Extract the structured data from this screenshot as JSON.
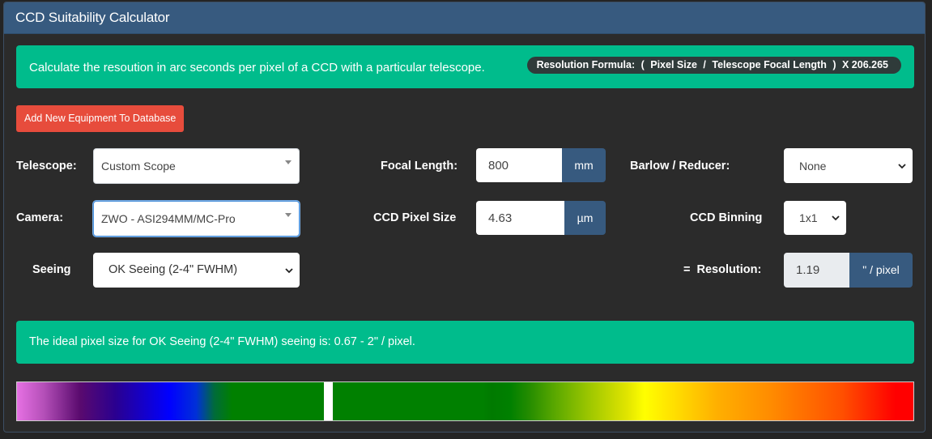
{
  "header": {
    "title": "CCD Suitability Calculator"
  },
  "info": {
    "description": "Calculate the resoution in arc seconds per pixel of a CCD with a particular telescope.",
    "formula": [
      "Resolution Formula:",
      "(",
      "Pixel Size",
      "/",
      "Telescope Focal Length",
      ")",
      "X 206.265"
    ]
  },
  "add_button_label": "Add New Equipment To Database",
  "telescope": {
    "label": "Telescope:",
    "value": "Custom Scope"
  },
  "focal_length": {
    "label": "Focal Length:",
    "value": "800",
    "unit": "mm"
  },
  "barlow": {
    "label": "Barlow / Reducer:",
    "value": "None"
  },
  "camera": {
    "label": "Camera:",
    "value": "ZWO - ASI294MM/MC-Pro"
  },
  "pixel_size": {
    "label": "CCD Pixel Size",
    "value": "4.63",
    "unit": "µm"
  },
  "binning": {
    "label": "CCD Binning",
    "value": "1x1"
  },
  "seeing": {
    "label": "Seeing",
    "value": "OK Seeing (2-4\" FWHM)"
  },
  "resolution": {
    "label": "=  Resolution:",
    "value": "1.19",
    "unit": "\" / pixel"
  },
  "ideal_message": "The ideal pixel size for OK Seeing (2-4\" FWHM) seeing is: 0.67 - 2\" / pixel.",
  "spectrum_bar": {
    "marker_position_pct": 34.8
  }
}
